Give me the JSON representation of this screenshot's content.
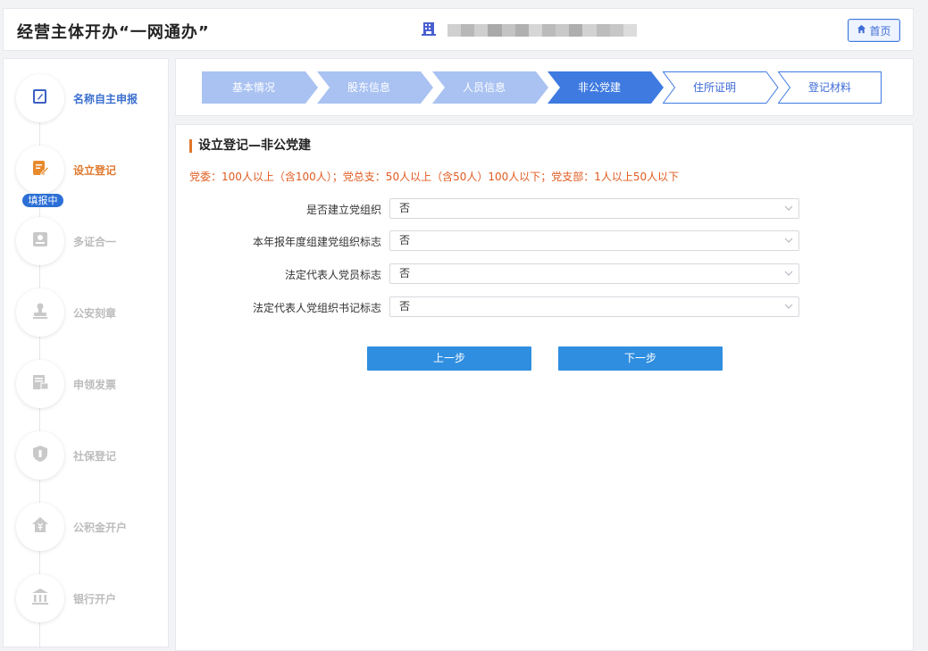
{
  "header": {
    "title": "经营主体开办“一网通办”",
    "home_label": "首页"
  },
  "sidebar": {
    "items": [
      {
        "label": "名称自主申报",
        "state": "done",
        "icon": "form-edit-icon"
      },
      {
        "label": "设立登记",
        "state": "active",
        "icon": "document-pen-icon"
      },
      {
        "label": "多证合一",
        "state": "pending",
        "icon": "id-card-icon"
      },
      {
        "label": "公安刻章",
        "state": "pending",
        "icon": "stamp-icon"
      },
      {
        "label": "申领发票",
        "state": "pending",
        "icon": "invoice-icon"
      },
      {
        "label": "社保登记",
        "state": "pending",
        "icon": "shield-icon"
      },
      {
        "label": "公积金开户",
        "state": "pending",
        "icon": "house-yen-icon"
      },
      {
        "label": "银行开户",
        "state": "pending",
        "icon": "bank-icon"
      }
    ],
    "badge": "填报中"
  },
  "stepper": {
    "steps": [
      {
        "label": "基本情况",
        "state": "done"
      },
      {
        "label": "股东信息",
        "state": "done"
      },
      {
        "label": "人员信息",
        "state": "done"
      },
      {
        "label": "非公党建",
        "state": "current"
      },
      {
        "label": "住所证明",
        "state": "todo"
      },
      {
        "label": "登记材料",
        "state": "todo"
      }
    ]
  },
  "section": {
    "title": "设立登记—非公党建",
    "notice": "党委：100人以上（含100人）；党总支：50人以上（含50人）100人以下；党支部：1人以上50人以下"
  },
  "form": {
    "fields": [
      {
        "label": "是否建立党组织",
        "value": "否"
      },
      {
        "label": "本年报年度组建党组织标志",
        "value": "否"
      },
      {
        "label": "法定代表人党员标志",
        "value": "否"
      },
      {
        "label": "法定代表人党组织书记标志",
        "value": "否"
      }
    ]
  },
  "buttons": {
    "prev_label": "上一步",
    "next_label": "下一步"
  },
  "colors": {
    "accent": "#2f8ee0",
    "step_done": "#a9c2f2",
    "step_current": "#3e7ae0",
    "warning": "#e05a1f"
  }
}
